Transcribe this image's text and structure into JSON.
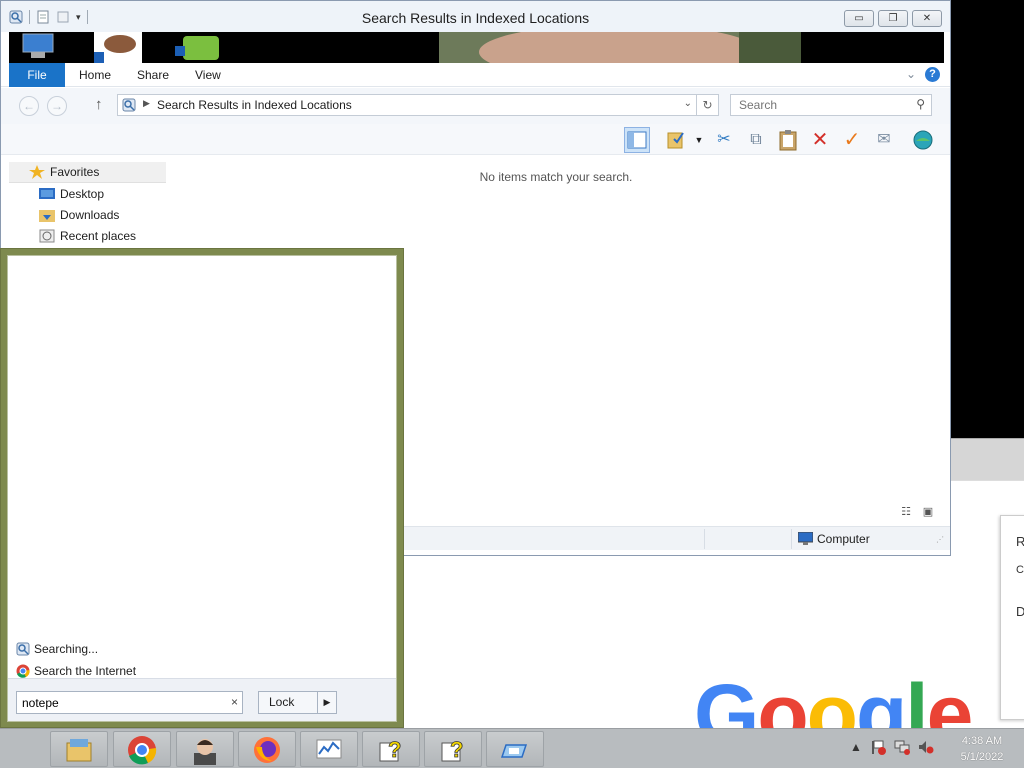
{
  "window": {
    "title": "Search Results in Indexed Locations",
    "buttons": {
      "minimize": "▭",
      "restore": "❐",
      "close": "✕"
    }
  },
  "ribbon": {
    "tabs": [
      "File",
      "Home",
      "Share",
      "View"
    ],
    "help": "?"
  },
  "navigation": {
    "back": "←",
    "forward": "→",
    "up": "↑",
    "address": "Search Results in Indexed Locations",
    "search_placeholder": "Search"
  },
  "nav_pane": {
    "favorites": "Favorites",
    "items": [
      "Desktop",
      "Downloads",
      "Recent places"
    ]
  },
  "content": {
    "empty_message": "No items match your search."
  },
  "statusbar": {
    "location": "Computer"
  },
  "start_search": {
    "results": [
      "Searching...",
      "Search the Internet"
    ],
    "query": "notepe",
    "clear": "×",
    "lock_label": "Lock",
    "lock_arrow": "▶"
  },
  "taskbar": {
    "apps": [
      "file-explorer-icon",
      "chrome-icon",
      "user-avatar-icon",
      "firefox-icon",
      "performance-monitor-icon",
      "help-icon",
      "help-icon-2",
      "virtual-box-icon"
    ],
    "time": "4:38 AM",
    "date": "5/1/2022"
  },
  "background": {
    "google_letters": [
      "G",
      "o",
      "o",
      "g",
      "l",
      "e"
    ],
    "side_card_letters": [
      "R",
      "C",
      "D"
    ]
  }
}
